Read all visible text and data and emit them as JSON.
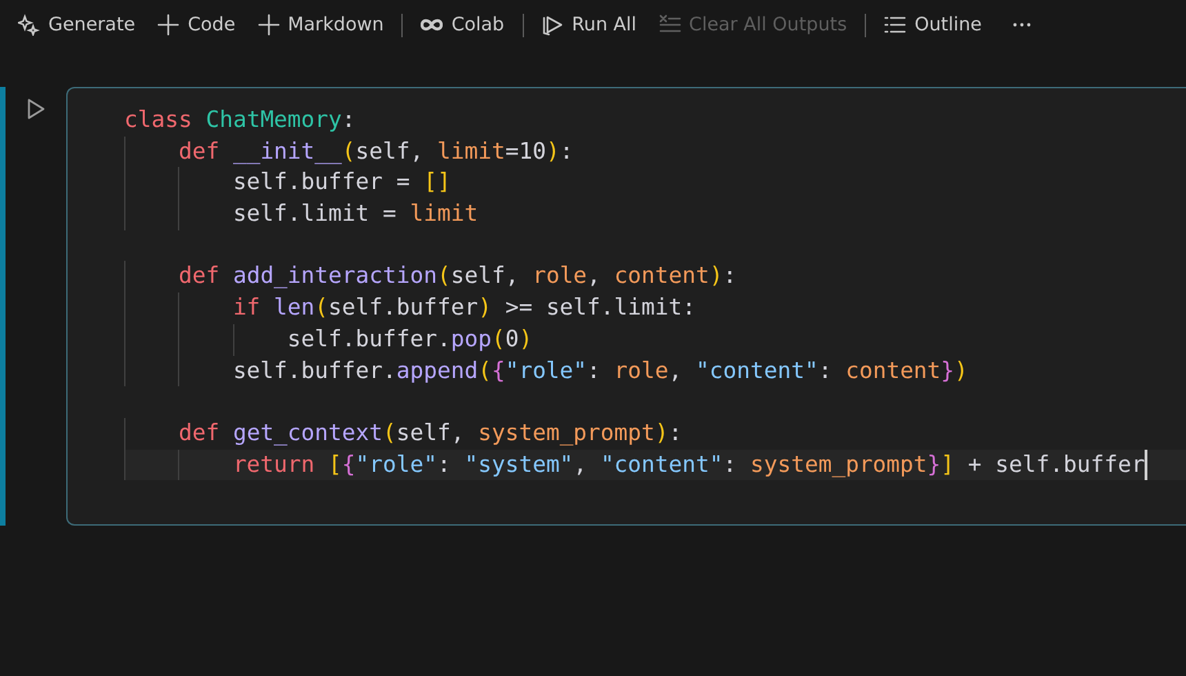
{
  "toolbar": [
    {
      "kind": "sparkle",
      "label": "Generate",
      "disabled": false
    },
    {
      "kind": "plus",
      "label": "Code",
      "disabled": false
    },
    {
      "kind": "plus",
      "label": "Markdown",
      "disabled": false
    },
    {
      "kind": "separator"
    },
    {
      "kind": "colab",
      "label": "Colab",
      "disabled": false
    },
    {
      "kind": "separator"
    },
    {
      "kind": "runall",
      "label": "Run All",
      "disabled": false
    },
    {
      "kind": "clear",
      "label": "Clear All Outputs",
      "disabled": true
    },
    {
      "kind": "separator"
    },
    {
      "kind": "outline",
      "label": "Outline",
      "disabled": false
    },
    {
      "kind": "more"
    }
  ],
  "cell": {
    "focused": true,
    "lines": [
      {
        "kind": "code",
        "current": false,
        "tokens": [
          {
            "kind": "keyword",
            "t": "class "
          },
          {
            "kind": "classname",
            "t": "ChatMemory"
          },
          {
            "kind": "plain",
            "t": ":"
          }
        ],
        "children": [
          {
            "kind": "code",
            "current": false,
            "tokens": [
              {
                "kind": "keyword",
                "t": "def "
              },
              {
                "kind": "function",
                "t": "__init__"
              },
              {
                "kind": "bracket",
                "t": "("
              },
              {
                "kind": "plain",
                "t": "self, "
              },
              {
                "kind": "param",
                "t": "limit"
              },
              {
                "kind": "plain",
                "t": "=10"
              },
              {
                "kind": "bracket",
                "t": ")"
              },
              {
                "kind": "plain",
                "t": ":"
              }
            ],
            "children": [
              {
                "kind": "code",
                "current": false,
                "tokens": [
                  {
                    "kind": "plain",
                    "t": "self.buffer = "
                  },
                  {
                    "kind": "bracket",
                    "t": "[]"
                  }
                ]
              },
              {
                "kind": "code",
                "current": false,
                "tokens": [
                  {
                    "kind": "plain",
                    "t": "self.limit = "
                  },
                  {
                    "kind": "param",
                    "t": "limit"
                  }
                ]
              }
            ]
          },
          {
            "kind": "blank"
          },
          {
            "kind": "code",
            "current": false,
            "tokens": [
              {
                "kind": "keyword",
                "t": "def "
              },
              {
                "kind": "function",
                "t": "add_interaction"
              },
              {
                "kind": "bracket",
                "t": "("
              },
              {
                "kind": "plain",
                "t": "self, "
              },
              {
                "kind": "param",
                "t": "role"
              },
              {
                "kind": "plain",
                "t": ", "
              },
              {
                "kind": "param",
                "t": "content"
              },
              {
                "kind": "bracket",
                "t": ")"
              },
              {
                "kind": "plain",
                "t": ":"
              }
            ],
            "children": [
              {
                "kind": "code",
                "current": false,
                "tokens": [
                  {
                    "kind": "keyword",
                    "t": "if "
                  },
                  {
                    "kind": "function",
                    "t": "len"
                  },
                  {
                    "kind": "bracket",
                    "t": "("
                  },
                  {
                    "kind": "plain",
                    "t": "self.buffer"
                  },
                  {
                    "kind": "bracket",
                    "t": ")"
                  },
                  {
                    "kind": "plain",
                    "t": " >= self.limit:"
                  }
                ],
                "children": [
                  {
                    "kind": "code",
                    "current": false,
                    "tokens": [
                      {
                        "kind": "plain",
                        "t": "self.buffer."
                      },
                      {
                        "kind": "function",
                        "t": "pop"
                      },
                      {
                        "kind": "bracket",
                        "t": "("
                      },
                      {
                        "kind": "plain",
                        "t": "0"
                      },
                      {
                        "kind": "bracket",
                        "t": ")"
                      }
                    ]
                  }
                ]
              },
              {
                "kind": "code",
                "current": false,
                "tokens": [
                  {
                    "kind": "plain",
                    "t": "self.buffer."
                  },
                  {
                    "kind": "function",
                    "t": "append"
                  },
                  {
                    "kind": "bracket",
                    "t": "("
                  },
                  {
                    "kind": "brace",
                    "t": "{"
                  },
                  {
                    "kind": "string",
                    "t": "\"role\""
                  },
                  {
                    "kind": "plain",
                    "t": ": "
                  },
                  {
                    "kind": "param",
                    "t": "role"
                  },
                  {
                    "kind": "plain",
                    "t": ", "
                  },
                  {
                    "kind": "string",
                    "t": "\"content\""
                  },
                  {
                    "kind": "plain",
                    "t": ": "
                  },
                  {
                    "kind": "param",
                    "t": "content"
                  },
                  {
                    "kind": "brace",
                    "t": "}"
                  },
                  {
                    "kind": "bracket",
                    "t": ")"
                  }
                ]
              }
            ]
          },
          {
            "kind": "blank"
          },
          {
            "kind": "code",
            "current": false,
            "tokens": [
              {
                "kind": "keyword",
                "t": "def "
              },
              {
                "kind": "function",
                "t": "get_context"
              },
              {
                "kind": "bracket",
                "t": "("
              },
              {
                "kind": "plain",
                "t": "self, "
              },
              {
                "kind": "param",
                "t": "system_prompt"
              },
              {
                "kind": "bracket",
                "t": ")"
              },
              {
                "kind": "plain",
                "t": ":"
              }
            ],
            "children": [
              {
                "kind": "code",
                "current": true,
                "tokens": [
                  {
                    "kind": "keyword",
                    "t": "return "
                  },
                  {
                    "kind": "bracket",
                    "t": "["
                  },
                  {
                    "kind": "brace",
                    "t": "{"
                  },
                  {
                    "kind": "string",
                    "t": "\"role\""
                  },
                  {
                    "kind": "plain",
                    "t": ": "
                  },
                  {
                    "kind": "string",
                    "t": "\"system\""
                  },
                  {
                    "kind": "plain",
                    "t": ", "
                  },
                  {
                    "kind": "string",
                    "t": "\"content\""
                  },
                  {
                    "kind": "plain",
                    "t": ": "
                  },
                  {
                    "kind": "param",
                    "t": "system_prompt"
                  },
                  {
                    "kind": "brace",
                    "t": "}"
                  },
                  {
                    "kind": "bracket",
                    "t": "]"
                  },
                  {
                    "kind": "plain",
                    "t": " + self.buffer"
                  }
                ]
              }
            ]
          }
        ]
      }
    ]
  }
}
